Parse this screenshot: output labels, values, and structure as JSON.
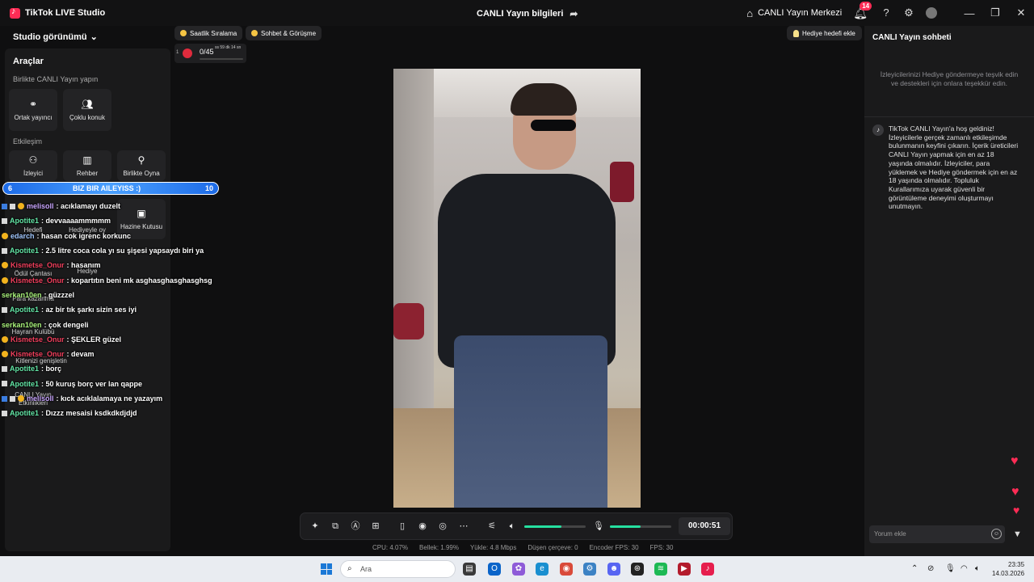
{
  "titlebar": {
    "app_title": "TikTok LIVE Studio",
    "center_title": "CANLI Yayın bilgileri",
    "home_link": "CANLI Yayın Merkezi",
    "notification_count": "14"
  },
  "left": {
    "studio_view": "Studio görünümü",
    "tools_title": "Araçlar",
    "section_together": "Birlikte CANLI Yayın yapın",
    "section_engagement": "Etkileşim",
    "tools": {
      "cohost": "Ortak yayıncı",
      "multiguest": "Çoklu konuk",
      "viewer": "İzleyici",
      "guide": "Rehber",
      "play_together": "Birlikte Oyna",
      "goal": "Hedefi",
      "gift_game": "Hediyeyle oy",
      "treasure": "Hazine Kutusu",
      "reward_bag": "Ödül Çantası",
      "gift": "Hediye",
      "earn_money": "Para kazanma",
      "fan_club": "Hayran Kulübü",
      "audience_expand": "Kitlenizi genişletin",
      "live_events": "CANLI Yayın Etkinlikleri"
    }
  },
  "pills": {
    "ranking": "Saatlik Sıralama",
    "chat_call": "Sohbet & Görüşme",
    "gift_goal": "Hediye hedefi ekle"
  },
  "goal_widget": {
    "count": "0/45",
    "time": "ss 59 dk 14 sn",
    "small": "1"
  },
  "banner": {
    "left": "6",
    "text": "BIZ BIR AILEYISS :)",
    "right": "10"
  },
  "chat": [
    {
      "user": "melisoll",
      "msg": ": acıklamayı duzelt",
      "color": "#c9a6ff"
    },
    {
      "user": "Apotite1",
      "msg": ": devvaaaammmmm",
      "color": "#63e6a6"
    },
    {
      "user": "edarch",
      "msg": ": hasan cok igrenc korkunc",
      "color": "#a3c9ff"
    },
    {
      "user": "Apotite1",
      "msg": ": 2.5 litre coca cola yı su şişesi yapsaydı biri ya",
      "color": "#63e6a6"
    },
    {
      "user": "Kismetse_Onur",
      "msg": ": hasanım",
      "color": "#f2405e"
    },
    {
      "user": "Kismetse_Onur",
      "msg": ": kopartıtın beni mk asghasghasghasghsg",
      "color": "#f2405e"
    },
    {
      "user": "serkan10en",
      "msg": ": güzzzel",
      "color": "#a9f27a"
    },
    {
      "user": "Apotite1",
      "msg": ": az bir tık şarkı sizin ses iyi",
      "color": "#63e6a6"
    },
    {
      "user": "serkan10en",
      "msg": ": çok dengeli",
      "color": "#a9f27a"
    },
    {
      "user": "Kismetse_Onur",
      "msg": ": ŞEKLER güzel",
      "color": "#f2405e"
    },
    {
      "user": "Kismetse_Onur",
      "msg": ": devam",
      "color": "#f2405e"
    },
    {
      "user": "Apotite1",
      "msg": ": borç",
      "color": "#63e6a6"
    },
    {
      "user": "Apotite1",
      "msg": ": 50 kuruş borç ver lan qappe",
      "color": "#63e6a6"
    },
    {
      "user": "melisoll",
      "msg": ": kıck acıklalamaya ne yazayım",
      "color": "#c9a6ff"
    },
    {
      "user": "Apotite1",
      "msg": ": Dızzz mesaisi ksdkdkdjdjd",
      "color": "#63e6a6"
    }
  ],
  "controls": {
    "timer": "00:00:51",
    "speaker_level": 0.6,
    "mic_level": 0.5
  },
  "stats": {
    "cpu": "CPU:  4.07%",
    "memory": "Bellek:  1.99%",
    "upload": "Yükle:  4.8 Mbps",
    "dropped": "Düşen çerçeve:  0",
    "encoder_fps": "Encoder FPS:  30",
    "fps": "FPS:  30"
  },
  "right": {
    "title": "CANLI Yayın sohbeti",
    "hint": "İzleyicilerinizi Hediye göndermeye teşvik edin ve destekleri için onlara teşekkür edin.",
    "welcome": "TikTok CANLI Yayın'a hoş geldiniz! İzleyicilerle gerçek zamanlı etkileşimde bulunmanın keyfini çıkarın. İçerik üreticileri CANLI Yayın yapmak için en az 18 yaşında olmalıdır. İzleyiciler, para yüklemek ve Hediye göndermek için en az 18 yaşında olmalıdır. Topluluk Kurallarımıza uyarak güvenli bir görüntüleme deneyimi oluşturmayı unutmayın.",
    "comment_placeholder": "Yorum ekle"
  },
  "taskbar": {
    "search": "Ara",
    "time": "23:35",
    "date": "14.03.2026"
  }
}
